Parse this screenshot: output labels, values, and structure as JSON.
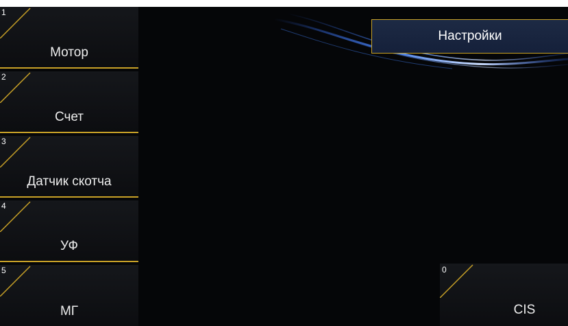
{
  "menu": {
    "items": [
      {
        "number": "1",
        "label": "Мотор"
      },
      {
        "number": "2",
        "label": "Счет"
      },
      {
        "number": "3",
        "label": "Датчик скотча"
      },
      {
        "number": "4",
        "label": "УФ"
      },
      {
        "number": "5",
        "label": "МГ"
      }
    ]
  },
  "header": {
    "settings_label": "Настройки"
  },
  "cis": {
    "number": "0",
    "label": "CIS"
  },
  "colors": {
    "background": "#050608",
    "accent_gold": "#c9a227",
    "header_blue": "#1d2a44",
    "swoosh_blue": "#2f6bff"
  }
}
